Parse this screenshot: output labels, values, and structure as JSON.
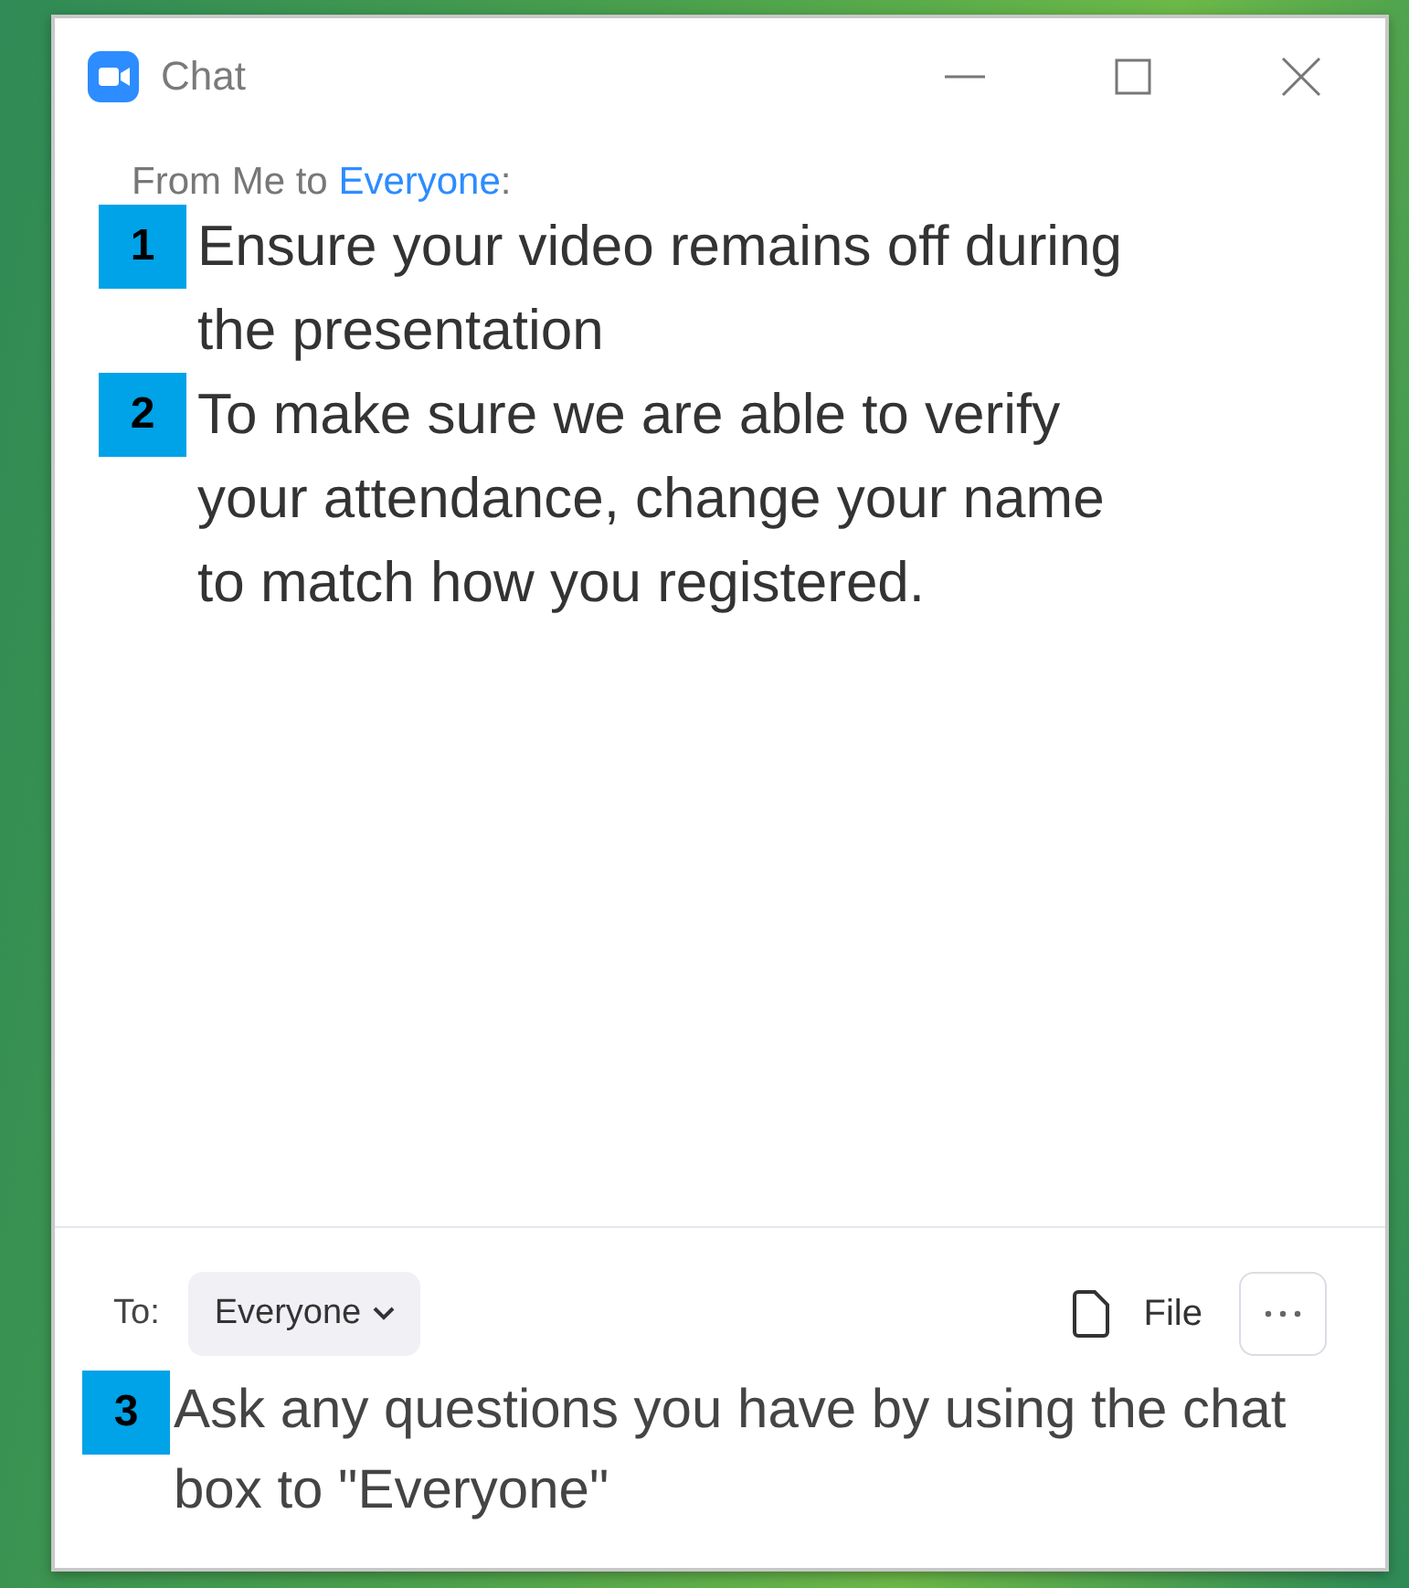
{
  "window": {
    "title": "Chat"
  },
  "messages": {
    "sender": "From Me to ",
    "recipient": "Everyone",
    "suffix": ":",
    "items": [
      {
        "badge": "1",
        "text": "Ensure your video remains off during the presentation"
      },
      {
        "badge": "2",
        "text": "To make sure we are able to verify your attendance, change your name to match how you registered."
      }
    ]
  },
  "composer": {
    "to_label": "To:",
    "recipient": "Everyone",
    "file_label": "File",
    "value": "Ask any questions you have by using the chat box to \"Everyone\"",
    "badge": "3"
  }
}
